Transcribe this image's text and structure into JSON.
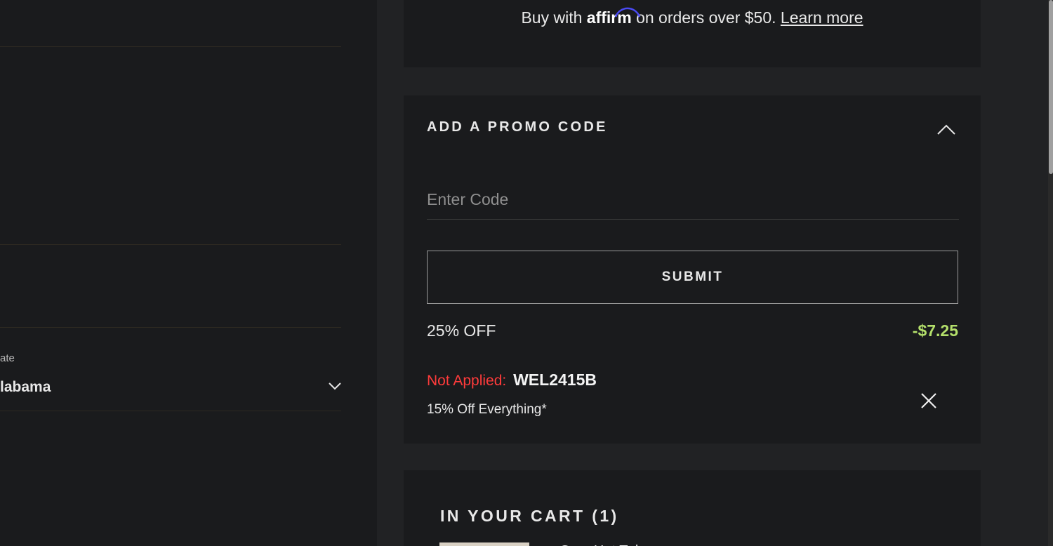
{
  "shipping_form": {
    "state_label": "ate",
    "state_value": "labama"
  },
  "affirm_banner": {
    "prefix": "Buy with",
    "logo_text": "affirm",
    "suffix": "on orders over $50.",
    "learn_more": "Learn more"
  },
  "promo": {
    "title": "ADD A PROMO CODE",
    "input_placeholder": "Enter Code",
    "input_value": "",
    "submit_label": "SUBMIT",
    "discount_label": "25% OFF",
    "discount_amount": "-$7.25",
    "not_applied_label": "Not Applied:",
    "not_applied_code": "WEL2415B",
    "not_applied_description": "15% Off Everything*"
  },
  "cart": {
    "title": "IN YOUR CART (1)",
    "first_item_name": "Grey Hot Tub"
  },
  "icons": {
    "state_dropdown": "chevron-down-icon",
    "promo_collapse": "chevron-up-icon",
    "remove_code": "close-icon"
  },
  "colors": {
    "background": "#1a1b1d",
    "panel_gap": "#212224",
    "discount_green": "#b4e06b",
    "error_red": "#ff3b3b",
    "affirm_arc": "#4a4af4"
  }
}
